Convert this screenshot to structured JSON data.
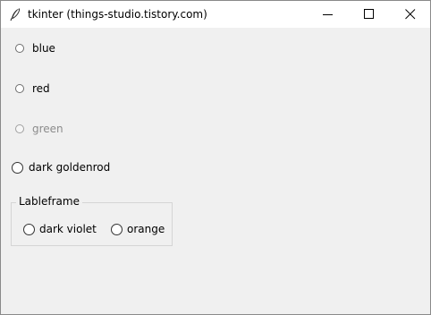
{
  "window": {
    "title": "tkinter (things-studio.tistory.com)",
    "icon": "feather-icon",
    "controls": [
      "minimize-icon",
      "maximize-icon",
      "close-icon"
    ]
  },
  "radios": [
    {
      "label": "blue",
      "selected": false,
      "disabled": false
    },
    {
      "label": "red",
      "selected": false,
      "disabled": false
    },
    {
      "label": "green",
      "selected": false,
      "disabled": true
    },
    {
      "label": "dark goldenrod",
      "selected": false,
      "disabled": false
    }
  ],
  "labelframe": {
    "title": "Lableframe",
    "radios": [
      {
        "label": "dark violet",
        "selected": false
      },
      {
        "label": "orange",
        "selected": false
      }
    ]
  },
  "colors": {
    "window_bg": "#f0f0f0",
    "titlebar_bg": "#ffffff",
    "disabled_text": "#8c8c8c"
  }
}
